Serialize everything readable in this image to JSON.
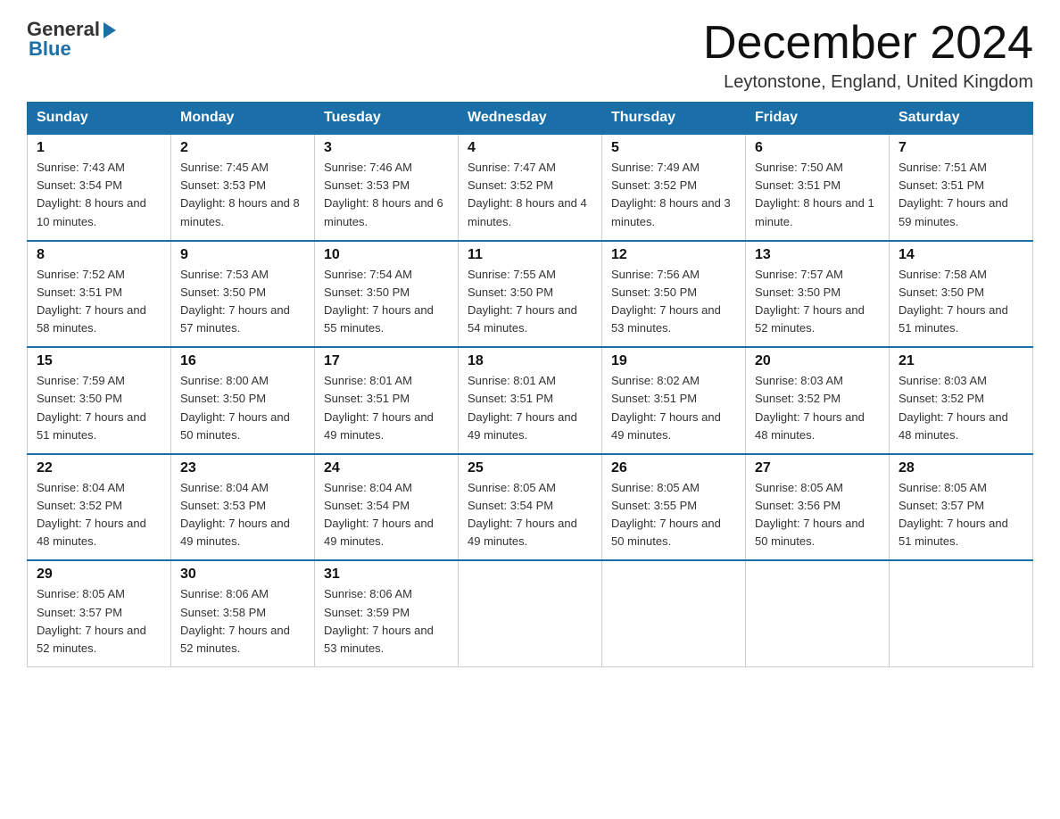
{
  "logo": {
    "general": "General",
    "blue": "Blue"
  },
  "header": {
    "title": "December 2024",
    "location": "Leytonstone, England, United Kingdom"
  },
  "days_of_week": [
    "Sunday",
    "Monday",
    "Tuesday",
    "Wednesday",
    "Thursday",
    "Friday",
    "Saturday"
  ],
  "weeks": [
    [
      {
        "day": "1",
        "sunrise": "7:43 AM",
        "sunset": "3:54 PM",
        "daylight": "8 hours and 10 minutes."
      },
      {
        "day": "2",
        "sunrise": "7:45 AM",
        "sunset": "3:53 PM",
        "daylight": "8 hours and 8 minutes."
      },
      {
        "day": "3",
        "sunrise": "7:46 AM",
        "sunset": "3:53 PM",
        "daylight": "8 hours and 6 minutes."
      },
      {
        "day": "4",
        "sunrise": "7:47 AM",
        "sunset": "3:52 PM",
        "daylight": "8 hours and 4 minutes."
      },
      {
        "day": "5",
        "sunrise": "7:49 AM",
        "sunset": "3:52 PM",
        "daylight": "8 hours and 3 minutes."
      },
      {
        "day": "6",
        "sunrise": "7:50 AM",
        "sunset": "3:51 PM",
        "daylight": "8 hours and 1 minute."
      },
      {
        "day": "7",
        "sunrise": "7:51 AM",
        "sunset": "3:51 PM",
        "daylight": "7 hours and 59 minutes."
      }
    ],
    [
      {
        "day": "8",
        "sunrise": "7:52 AM",
        "sunset": "3:51 PM",
        "daylight": "7 hours and 58 minutes."
      },
      {
        "day": "9",
        "sunrise": "7:53 AM",
        "sunset": "3:50 PM",
        "daylight": "7 hours and 57 minutes."
      },
      {
        "day": "10",
        "sunrise": "7:54 AM",
        "sunset": "3:50 PM",
        "daylight": "7 hours and 55 minutes."
      },
      {
        "day": "11",
        "sunrise": "7:55 AM",
        "sunset": "3:50 PM",
        "daylight": "7 hours and 54 minutes."
      },
      {
        "day": "12",
        "sunrise": "7:56 AM",
        "sunset": "3:50 PM",
        "daylight": "7 hours and 53 minutes."
      },
      {
        "day": "13",
        "sunrise": "7:57 AM",
        "sunset": "3:50 PM",
        "daylight": "7 hours and 52 minutes."
      },
      {
        "day": "14",
        "sunrise": "7:58 AM",
        "sunset": "3:50 PM",
        "daylight": "7 hours and 51 minutes."
      }
    ],
    [
      {
        "day": "15",
        "sunrise": "7:59 AM",
        "sunset": "3:50 PM",
        "daylight": "7 hours and 51 minutes."
      },
      {
        "day": "16",
        "sunrise": "8:00 AM",
        "sunset": "3:50 PM",
        "daylight": "7 hours and 50 minutes."
      },
      {
        "day": "17",
        "sunrise": "8:01 AM",
        "sunset": "3:51 PM",
        "daylight": "7 hours and 49 minutes."
      },
      {
        "day": "18",
        "sunrise": "8:01 AM",
        "sunset": "3:51 PM",
        "daylight": "7 hours and 49 minutes."
      },
      {
        "day": "19",
        "sunrise": "8:02 AM",
        "sunset": "3:51 PM",
        "daylight": "7 hours and 49 minutes."
      },
      {
        "day": "20",
        "sunrise": "8:03 AM",
        "sunset": "3:52 PM",
        "daylight": "7 hours and 48 minutes."
      },
      {
        "day": "21",
        "sunrise": "8:03 AM",
        "sunset": "3:52 PM",
        "daylight": "7 hours and 48 minutes."
      }
    ],
    [
      {
        "day": "22",
        "sunrise": "8:04 AM",
        "sunset": "3:52 PM",
        "daylight": "7 hours and 48 minutes."
      },
      {
        "day": "23",
        "sunrise": "8:04 AM",
        "sunset": "3:53 PM",
        "daylight": "7 hours and 49 minutes."
      },
      {
        "day": "24",
        "sunrise": "8:04 AM",
        "sunset": "3:54 PM",
        "daylight": "7 hours and 49 minutes."
      },
      {
        "day": "25",
        "sunrise": "8:05 AM",
        "sunset": "3:54 PM",
        "daylight": "7 hours and 49 minutes."
      },
      {
        "day": "26",
        "sunrise": "8:05 AM",
        "sunset": "3:55 PM",
        "daylight": "7 hours and 50 minutes."
      },
      {
        "day": "27",
        "sunrise": "8:05 AM",
        "sunset": "3:56 PM",
        "daylight": "7 hours and 50 minutes."
      },
      {
        "day": "28",
        "sunrise": "8:05 AM",
        "sunset": "3:57 PM",
        "daylight": "7 hours and 51 minutes."
      }
    ],
    [
      {
        "day": "29",
        "sunrise": "8:05 AM",
        "sunset": "3:57 PM",
        "daylight": "7 hours and 52 minutes."
      },
      {
        "day": "30",
        "sunrise": "8:06 AM",
        "sunset": "3:58 PM",
        "daylight": "7 hours and 52 minutes."
      },
      {
        "day": "31",
        "sunrise": "8:06 AM",
        "sunset": "3:59 PM",
        "daylight": "7 hours and 53 minutes."
      },
      null,
      null,
      null,
      null
    ]
  ]
}
